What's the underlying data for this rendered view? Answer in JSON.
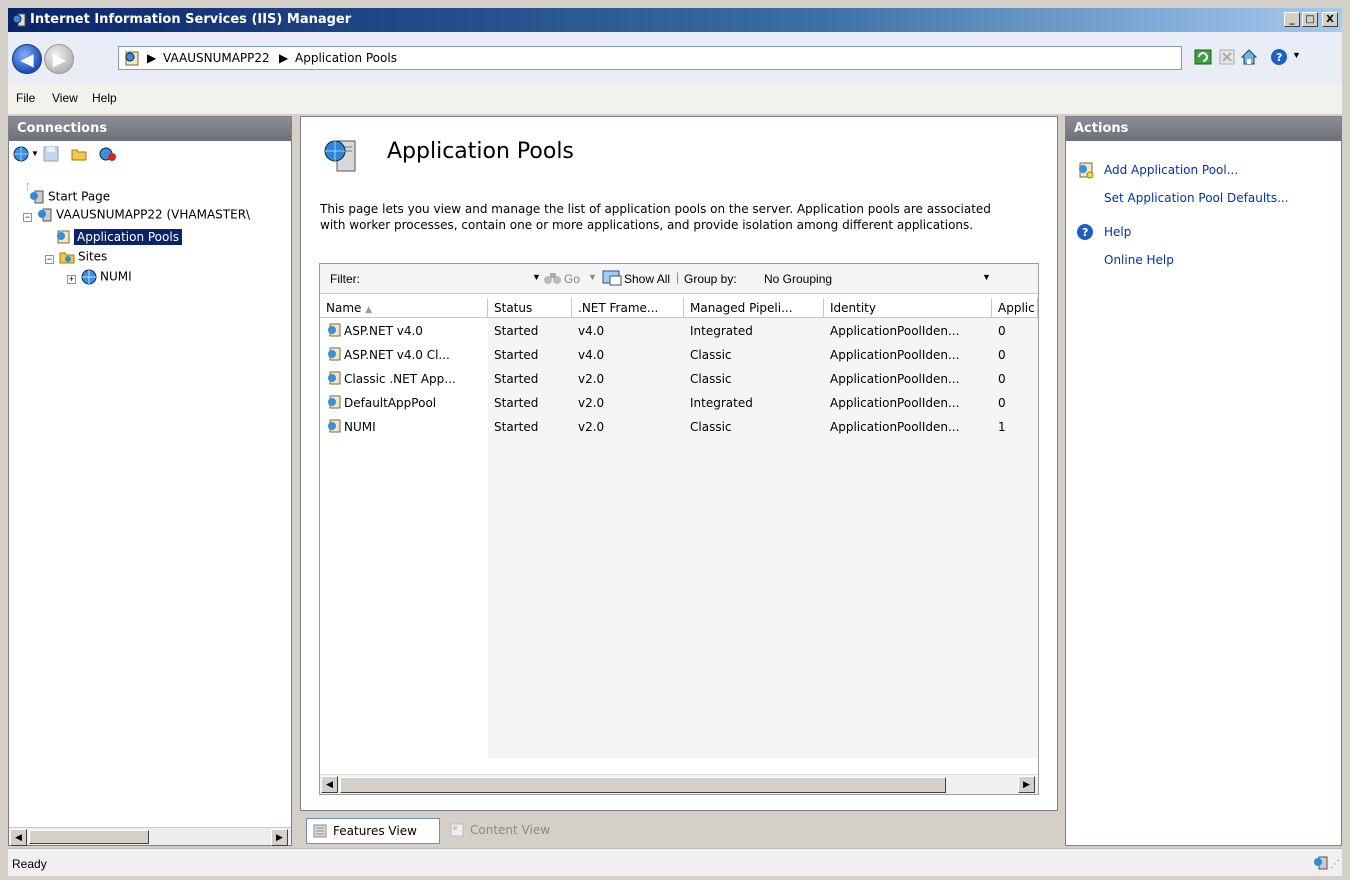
{
  "window": {
    "title": "Internet Information Services (IIS) Manager",
    "buttons": [
      "_",
      "□",
      "X"
    ]
  },
  "address": {
    "path": [
      "VAAUSNUMAPP22",
      "Application Pools"
    ]
  },
  "menu": [
    "File",
    "View",
    "Help"
  ],
  "connections": {
    "header": "Connections",
    "tree": {
      "start_page": "Start Page",
      "server": "VAAUSNUMAPP22 (VHAMASTER\\",
      "app_pools": "Application Pools",
      "sites": "Sites",
      "site_numi": "NUMI"
    }
  },
  "main": {
    "title": "Application Pools",
    "description": "This page lets you view and manage the list of application pools on the server. Application pools are associated with worker processes, contain one or more applications, and provide isolation among different applications.",
    "filter": {
      "label": "Filter:",
      "go": "Go",
      "show_all": "Show All",
      "group_by_label": "Group by:",
      "group_by_value": "No Grouping"
    },
    "columns": [
      "Name",
      "Status",
      ".NET Frame...",
      "Managed Pipeli...",
      "Identity",
      "Applic"
    ],
    "rows": [
      [
        "ASP.NET v4.0",
        "Started",
        "v4.0",
        "Integrated",
        "ApplicationPoolIden...",
        "0"
      ],
      [
        "ASP.NET v4.0 Cl...",
        "Started",
        "v4.0",
        "Classic",
        "ApplicationPoolIden...",
        "0"
      ],
      [
        "Classic .NET App...",
        "Started",
        "v2.0",
        "Classic",
        "ApplicationPoolIden...",
        "0"
      ],
      [
        "DefaultAppPool",
        "Started",
        "v2.0",
        "Integrated",
        "ApplicationPoolIden...",
        "0"
      ],
      [
        "NUMI",
        "Started",
        "v2.0",
        "Classic",
        "ApplicationPoolIden...",
        "1"
      ]
    ],
    "views": {
      "features": "Features View",
      "content": "Content View"
    }
  },
  "actions": {
    "header": "Actions",
    "items": {
      "add_pool": "Add Application Pool...",
      "set_defaults": "Set Application Pool Defaults...",
      "help": "Help",
      "online_help": "Online Help"
    }
  },
  "status": {
    "text": "Ready"
  },
  "colors": {
    "selection": "#0a246a",
    "link": "#0033aa",
    "panel_header": "#6e7079"
  }
}
